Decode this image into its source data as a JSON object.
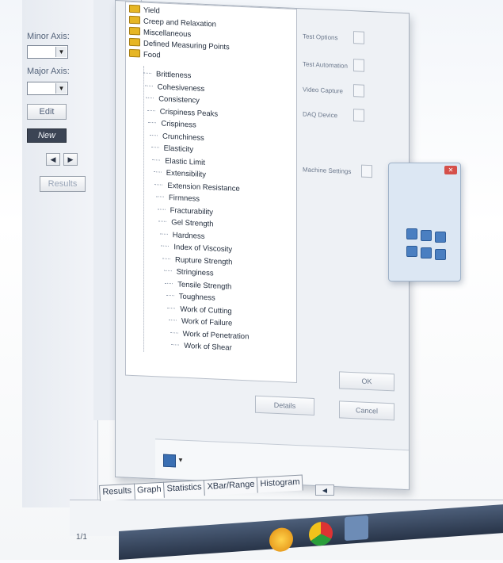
{
  "left_panel": {
    "minor_axis_label": "Minor Axis:",
    "major_axis_label": "Major Axis:",
    "minor_axis_value": "",
    "major_axis_value": "",
    "edit_label": "Edit",
    "new_label": "New",
    "prev_glyph": "◀",
    "next_glyph": "▶",
    "results_label": "Results"
  },
  "tree": {
    "folders": [
      "Yield",
      "Creep and Relaxation",
      "Miscellaneous",
      "Defined Measuring Points",
      "Food"
    ],
    "food_items": [
      "Brittleness",
      "Cohesiveness",
      "Consistency",
      "Crispiness Peaks",
      "Crispiness",
      "Crunchiness",
      "Elasticity",
      "Elastic Limit",
      "Extensibility",
      "Extension Resistance",
      "Firmness",
      "Fracturability",
      "Gel Strength",
      "Hardness",
      "Index of Viscosity",
      "Rupture Strength",
      "Stringiness",
      "Tensile Strength",
      "Toughness",
      "Work of Cutting",
      "Work of Failure",
      "Work of Penetration",
      "Work of Shear"
    ]
  },
  "dialog": {
    "side_options": [
      "Test Options",
      "Test Automation",
      "Video Capture",
      "DAQ Device",
      "Machine Settings"
    ],
    "details_label": "Details",
    "ok_label": "OK",
    "cancel_label": "Cancel"
  },
  "mini_window": {
    "title": "",
    "close_glyph": "✕"
  },
  "bottom_tabs": [
    "Results",
    "Graph",
    "Statistics",
    "XBar/Range",
    "Histogram"
  ],
  "page_count": "1/1",
  "icons": {
    "folder": "folder-icon",
    "doc": "document-icon",
    "chrome": "chrome-icon",
    "sun": "app-icon"
  },
  "colors": {
    "folder": "#e6b625",
    "new_button": "#3b4454",
    "taskbar": "#283448",
    "close": "#d5504a"
  }
}
